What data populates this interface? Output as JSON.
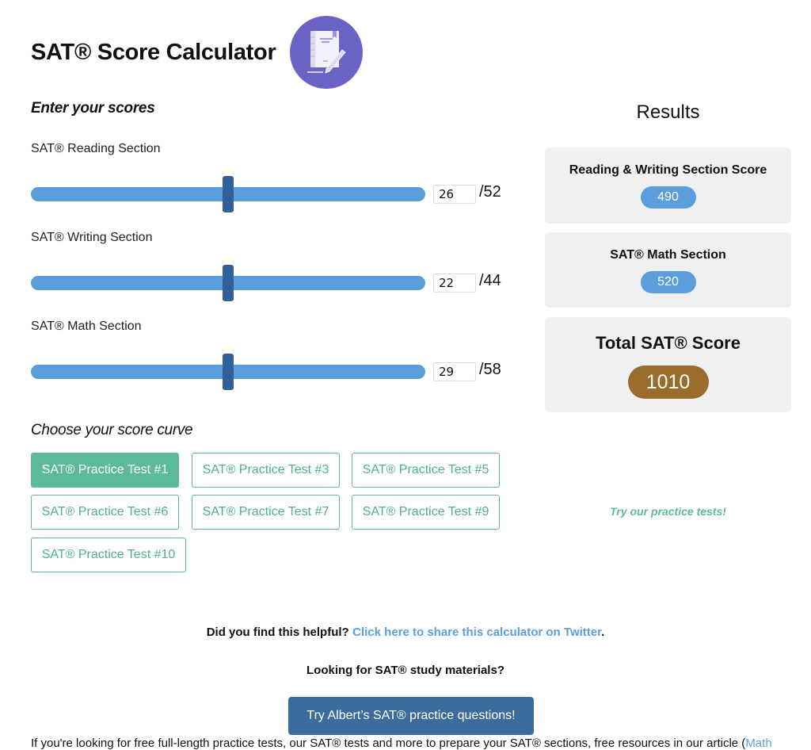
{
  "header": {
    "title": "SAT® Score Calculator",
    "logo_icon": "notebook-pencil-icon",
    "logo_color": "#6a63c4"
  },
  "inputs": {
    "heading": "Enter your scores",
    "sections": [
      {
        "label": "SAT® Reading Section",
        "value": "26",
        "max": 52,
        "max_label": "/52"
      },
      {
        "label": "SAT® Writing Section",
        "value": "22",
        "max": 44,
        "max_label": "/44"
      },
      {
        "label": "SAT® Math Section",
        "value": "29",
        "max": 58,
        "max_label": "/58"
      }
    ]
  },
  "curve": {
    "heading": "Choose your score curve",
    "options": [
      {
        "label": "SAT® Practice Test #1",
        "active": true
      },
      {
        "label": "SAT® Practice Test #3",
        "active": false
      },
      {
        "label": "SAT® Practice Test #5",
        "active": false
      },
      {
        "label": "SAT® Practice Test #6",
        "active": false
      },
      {
        "label": "SAT® Practice Test #7",
        "active": false
      },
      {
        "label": "SAT® Practice Test #9",
        "active": false
      },
      {
        "label": "SAT® Practice Test #10",
        "active": false
      }
    ]
  },
  "results": {
    "title": "Results",
    "reading_writing": {
      "label": "Reading & Writing Section Score",
      "score": "490"
    },
    "math": {
      "label": "SAT® Math Section",
      "score": "520"
    },
    "total": {
      "label": "Total SAT® Score",
      "score": "1010"
    },
    "promo_link": "Try our practice tests!"
  },
  "footer": {
    "helpful_text": "Did you find this helpful?",
    "twitter_link": "Click here to share this calculator on Twitter",
    "helpful_suffix": ".",
    "study_text": "Looking for SAT® study materials?",
    "cta_button": "Try Albert’s SAT® practice questions!",
    "clipped_text": "If you're looking for free full-length practice tests, our SAT® tests and more to prepare your SAT® sections, free resources in our article (",
    "clipped_link": "Math"
  },
  "colors": {
    "slider_track": "#5a9fdc",
    "slider_thumb": "#34609a",
    "accent_green": "#5cb99a",
    "score_pill": "#5a9fdc",
    "total_pill": "#9a6c2c",
    "cta": "#3b6c9c"
  }
}
